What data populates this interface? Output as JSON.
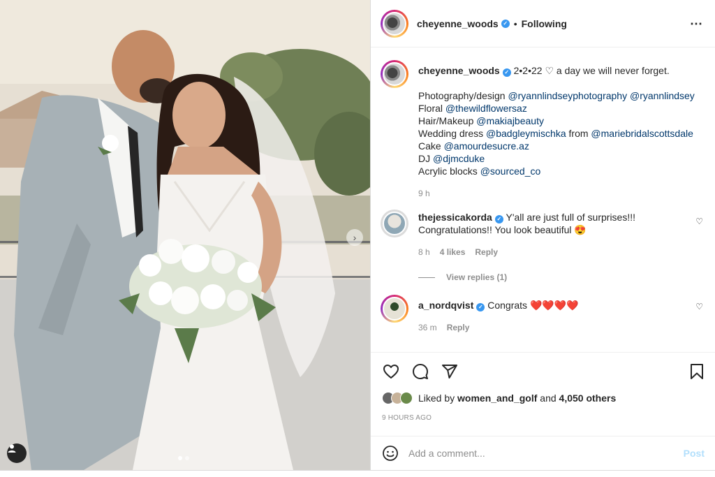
{
  "header": {
    "username": "cheyenne_woods",
    "separator": "•",
    "follow_status": "Following",
    "more_icon": "more-horizontal-icon"
  },
  "photo": {
    "next_icon": "chevron-right-icon",
    "user_tag_icon": "user-icon"
  },
  "caption": {
    "username": "cheyenne_woods",
    "text_prefix": "2•2•22 ",
    "heart": "♡",
    "text_suffix": " a day we will never forget.",
    "credits": [
      {
        "label": "Photography/design ",
        "mentions": [
          "@ryannlindseyphotography",
          "@ryannlindsey"
        ]
      },
      {
        "label": "Floral ",
        "mentions": [
          "@thewildflowersaz"
        ]
      },
      {
        "label": "Hair/Makeup ",
        "mentions": [
          "@makiajbeauty"
        ]
      },
      {
        "label": "Wedding dress ",
        "mentions": [
          "@badgleymischka"
        ],
        "middle": " from ",
        "mentions2": [
          "@mariebridalscottsdale"
        ]
      },
      {
        "label": "Cake ",
        "mentions": [
          "@amourdesucre.az"
        ]
      },
      {
        "label": "DJ ",
        "mentions": [
          "@djmcduke"
        ]
      },
      {
        "label": "Acrylic blocks ",
        "mentions": [
          "@sourced_co"
        ]
      }
    ],
    "time": "9 h"
  },
  "comments": [
    {
      "username": "thejessicakorda",
      "line1": "Y'all are just full of surprises!!!",
      "line2": "Congratulations!! You look beautiful 😍",
      "time": "8 h",
      "likes": "4 likes",
      "reply": "Reply"
    },
    {
      "username": "a_nordqvist",
      "text": "Congrats ",
      "hearts": "❤️❤️❤️❤️",
      "time": "36 m",
      "reply": "Reply"
    }
  ],
  "view_replies": "View replies (1)",
  "actions": {
    "like_icon": "heart-icon",
    "comment_icon": "comment-icon",
    "share_icon": "send-icon",
    "save_icon": "bookmark-icon"
  },
  "likes": {
    "prefix": "Liked by ",
    "user": "women_and_golf",
    "middle": " and ",
    "others": "4,050 others"
  },
  "time_ago": "9 HOURS AGO",
  "add_comment": {
    "placeholder": "Add a comment...",
    "post_label": "Post",
    "emoji_icon": "emoji-icon"
  },
  "colors": {
    "mention": "#00376b",
    "verified": "#3897f0",
    "post_disabled": "#b2dffc"
  }
}
